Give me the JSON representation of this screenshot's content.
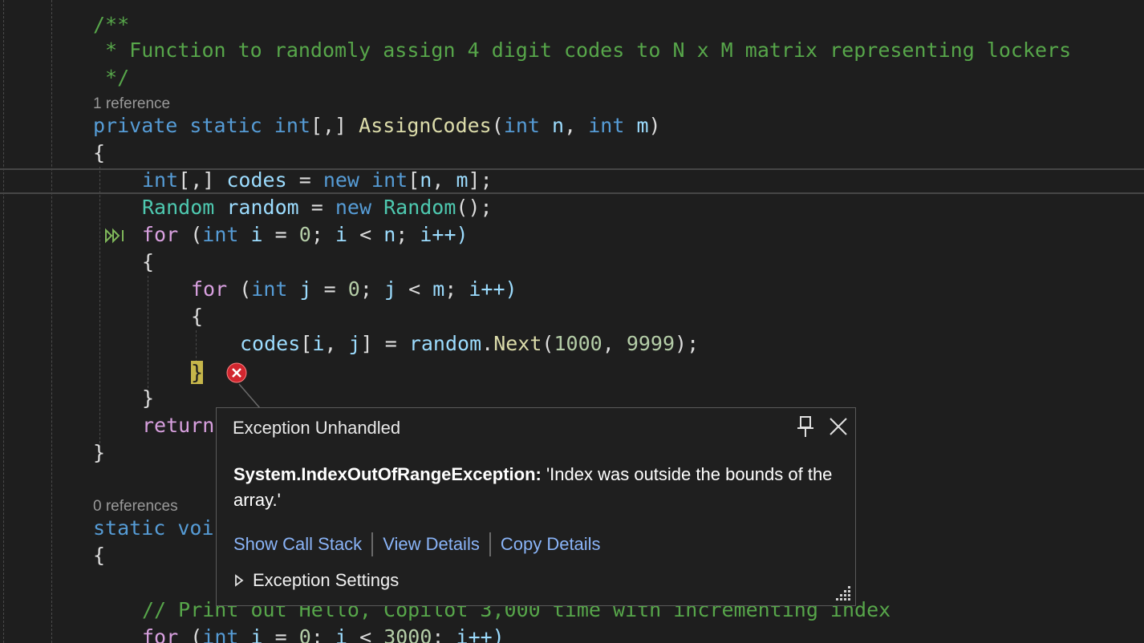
{
  "code": {
    "comment_open": "/**",
    "comment_body": " * Function to randomly assign 4 digit codes to N x M matrix representing lockers",
    "comment_close": " */",
    "codelens_1": "1 reference",
    "sig": {
      "private": "private",
      "static": "static",
      "int_type": "int",
      "brackets": "[,]",
      "method": "AssignCodes",
      "paren_open": "(",
      "int_n": "int",
      "n": "n",
      "comma": ",",
      "int_m": "int",
      "m": "m",
      "paren_close": ")"
    },
    "brace_open_1": "{",
    "l_codes": {
      "int": "int",
      "br": "[,]",
      "var": "codes",
      "eq": "=",
      "new": "new",
      "int2": "int",
      "open": "[",
      "n": "n",
      "comma": ",",
      "m": "m",
      "close": "];"
    },
    "l_random": {
      "type": "Random",
      "var": "random",
      "eq": "=",
      "new": "new",
      "ctor": "Random",
      "end": "();"
    },
    "l_for1": {
      "for": "for",
      "open": "(",
      "int": "int",
      "i": "i",
      "eq": "=",
      "zero": "0",
      "semi1": ";",
      "i2": "i",
      "lt": "<",
      "n": "n",
      "semi2": ";",
      "inc": "i++)"
    },
    "brace_open_2": "{",
    "l_for2": {
      "for": "for",
      "open": "(",
      "int": "int",
      "j": "j",
      "eq": "=",
      "zero": "0",
      "semi1": ";",
      "j2": "j",
      "lt": "<",
      "m": "m",
      "semi2": ";",
      "inc": "i++)"
    },
    "brace_open_3": "{",
    "l_assign": {
      "codes": "codes",
      "open": "[",
      "i": "i",
      "comma": ",",
      "j": "j",
      "close": "]",
      "eq": "=",
      "random": "random",
      "dot": ".",
      "next": "Next",
      "args_open": "(",
      "a1": "1000",
      "comma2": ",",
      "a2": "9999",
      "end": ");"
    },
    "brace_close_3": "}",
    "brace_close_2": "}",
    "return_kw": "return",
    "brace_close_1": "}",
    "codelens_2": "0 references",
    "static_kw": "static",
    "void_partial": "voi",
    "brace_open_main": "{",
    "comment_print": "// Print out Hello, Copilot 3,000 time with incrementing index",
    "l_for3": {
      "for": "for",
      "open": "(",
      "int": "int",
      "i": "i",
      "eq": "=",
      "zero": "0",
      "semi1": ";",
      "i2": "i",
      "lt": "<",
      "num": "3000",
      "semi2": ";",
      "inc": "i++)"
    }
  },
  "exception_popup": {
    "title": "Exception Unhandled",
    "exception_type": "System.IndexOutOfRangeException:",
    "message": " 'Index was outside the bounds of the array.'",
    "actions": {
      "show_call_stack": "Show Call Stack",
      "view_details": "View Details",
      "copy_details": "Copy Details"
    },
    "settings_label": "Exception Settings",
    "icons": {
      "pin": "pin-icon",
      "close": "close-icon",
      "expand": "chevron-right-icon",
      "resize": "resize-grip-icon",
      "error": "error-icon",
      "next_statement": "next-statement-icon"
    }
  },
  "colors": {
    "background": "#1e1e1e",
    "keyword": "#569cd6",
    "control_keyword": "#d8a0df",
    "type": "#4ec9b0",
    "method": "#dcdcaa",
    "number": "#b5cea8",
    "variable": "#9cdcfe",
    "comment": "#57a64a",
    "link": "#8ab4f8",
    "error": "#d1262f"
  }
}
